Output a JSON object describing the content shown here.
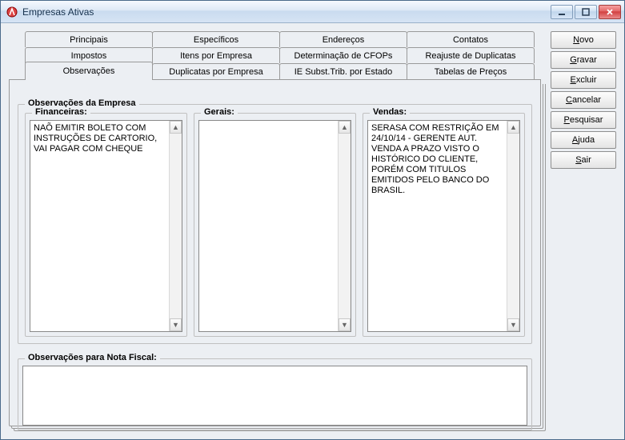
{
  "window": {
    "title": "Empresas Ativas"
  },
  "tabs": {
    "row1": [
      "Principais",
      "Específicos",
      "Endereços",
      "Contatos"
    ],
    "row2": [
      "Impostos",
      "Itens por Empresa",
      "Determinação de CFOPs",
      "Reajuste de Duplicatas"
    ],
    "row3": [
      "Observações",
      "Duplicatas por Empresa",
      "IE Subst.Trib. por Estado",
      "Tabelas de Preços"
    ]
  },
  "groups": {
    "obs_empresa_label": "Observações da Empresa",
    "financeiras_label": "Financeiras:",
    "gerais_label": "Gerais:",
    "vendas_label": "Vendas:",
    "obs_nf_label": "Observações para Nota Fiscal:"
  },
  "textareas": {
    "financeiras": "NAÕ EMITIR BOLETO COM INSTRUÇÕES DE CARTORIO, VAI PAGAR COM CHEQUE",
    "gerais": "",
    "vendas": "SERASA COM RESTRIÇÃO EM 24/10/14 - GERENTE AUT. VENDA A PRAZO VISTO O HISTÓRICO DO CLIENTE, PORÉM COM TITULOS EMITIDOS PELO BANCO DO BRASIL.",
    "nota_fiscal": ""
  },
  "buttons": {
    "novo": "ovo",
    "gravar": "ravar",
    "excluir": "xcluir",
    "cancelar": "ancelar",
    "pesquisar": "esquisar",
    "ajuda": "juda",
    "sair": "air"
  },
  "accel": {
    "novo": "N",
    "gravar": "G",
    "excluir": "E",
    "cancelar": "C",
    "pesquisar": "P",
    "ajuda": "A",
    "sair": "S"
  }
}
